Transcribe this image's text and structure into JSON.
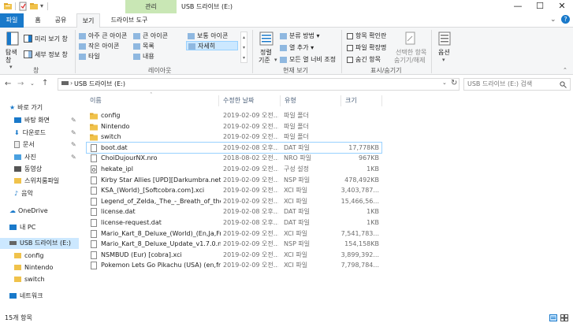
{
  "window": {
    "title": "USB 드라이브 (E:)",
    "context_tab": "관리",
    "minimize": "—",
    "maximize": "☐",
    "close": "✕",
    "help": "?"
  },
  "tabs": {
    "file": "파일",
    "home": "홈",
    "share": "공유",
    "view": "보기",
    "drive_tools": "드라이브 도구"
  },
  "ribbon": {
    "pane": {
      "nav_pane": "탐색",
      "nav_pane2": "창",
      "preview": "미리 보기 창",
      "details": "세부 정보 창",
      "group": "창"
    },
    "layout": {
      "items": [
        "아주 큰 아이콘",
        "큰 아이콘",
        "보통 아이콘",
        "작은 아이콘",
        "목록",
        "자세히",
        "타일",
        "내용"
      ],
      "group": "레이아웃"
    },
    "current_view": {
      "sort": "정렬",
      "sort2": "기준",
      "group_by": "분류 방법",
      "add_columns": "열 추가",
      "fit_columns": "모든 열 너비 조정",
      "group": "현재 보기"
    },
    "show_hide": {
      "item_checkboxes": "항목 확인란",
      "file_extensions": "파일 확장명",
      "hidden_items": "숨긴 항목",
      "hide_selected": "선택한 항목",
      "hide_selected2": "숨기기/해제",
      "group": "표시/숨기기"
    },
    "options": "옵션"
  },
  "address": {
    "path": "USB 드라이브 (E:)",
    "search_placeholder": "USB 드라이브 (E:) 검색"
  },
  "nav": {
    "quick_access": "바로 가기",
    "desktop": "바탕 화면",
    "downloads": "다운로드",
    "documents": "문서",
    "pictures": "사진",
    "videos": "동영상",
    "switch_save": "스위치룸파일",
    "music": "음악",
    "onedrive": "OneDrive",
    "this_pc": "내 PC",
    "usb": "USB 드라이브 (E:)",
    "sub_config": "config",
    "sub_nintendo": "Nintendo",
    "sub_switch": "switch",
    "network": "네트워크"
  },
  "columns": {
    "name": "이름",
    "date": "수정한 날짜",
    "type": "유형",
    "size": "크기"
  },
  "files": [
    {
      "name": "config",
      "date": "2019-02-09 오전...",
      "type": "파일 폴더",
      "size": "",
      "kind": "folder"
    },
    {
      "name": "Nintendo",
      "date": "2019-02-09 오전...",
      "type": "파일 폴더",
      "size": "",
      "kind": "folder"
    },
    {
      "name": "switch",
      "date": "2019-02-09 오전...",
      "type": "파일 폴더",
      "size": "",
      "kind": "folder"
    },
    {
      "name": "boot.dat",
      "date": "2019-02-08 오후...",
      "type": "DAT 파일",
      "size": "17,778KB",
      "kind": "file"
    },
    {
      "name": "ChoiDujourNX.nro",
      "date": "2018-08-02 오전...",
      "type": "NRO 파일",
      "size": "967KB",
      "kind": "file"
    },
    {
      "name": "hekate_ipl",
      "date": "2019-02-09 오전...",
      "type": "구성 설정",
      "size": "1KB",
      "kind": "config"
    },
    {
      "name": "Kirby Star Allies [UPD][Darkumbra.net][...",
      "date": "2019-02-09 오전...",
      "type": "NSP 파일",
      "size": "478,492KB",
      "kind": "file"
    },
    {
      "name": "KSA_(World)_[Softcobra.com].xci",
      "date": "2019-02-09 오전...",
      "type": "XCI 파일",
      "size": "3,403,787...",
      "kind": "file"
    },
    {
      "name": "Legend_of_Zelda,_The_-_Breath_of_the_...",
      "date": "2019-02-09 오전...",
      "type": "XCI 파일",
      "size": "15,466,56...",
      "kind": "file"
    },
    {
      "name": "license.dat",
      "date": "2019-02-08 오후...",
      "type": "DAT 파일",
      "size": "1KB",
      "kind": "file"
    },
    {
      "name": "license-request.dat",
      "date": "2019-02-08 오후...",
      "type": "DAT 파일",
      "size": "1KB",
      "kind": "file"
    },
    {
      "name": "Mario_Kart_8_Deluxe_(World)_(En,Ja,Fr,D...",
      "date": "2019-02-09 오전...",
      "type": "XCI 파일",
      "size": "7,541,783...",
      "kind": "file"
    },
    {
      "name": "Mario_Kart_8_Deluxe_Update_v1.7.0.nsp",
      "date": "2019-02-09 오전...",
      "type": "NSP 파일",
      "size": "154,158KB",
      "kind": "file"
    },
    {
      "name": "NSMBUD (Eur) [cobra].xci",
      "date": "2019-02-09 오전...",
      "type": "XCI 파일",
      "size": "3,899,392...",
      "kind": "file"
    },
    {
      "name": "Pokemon Lets Go Pikachu (USA) (en,fr,...",
      "date": "2019-02-09 오전...",
      "type": "XCI 파일",
      "size": "7,798,784...",
      "kind": "file"
    }
  ],
  "status": {
    "count": "15개 항목"
  },
  "colors": {
    "file_tab": "#1979ca",
    "context": "#c9e7b5",
    "folder": "#f0c24b",
    "selected": "#cce8ff"
  }
}
